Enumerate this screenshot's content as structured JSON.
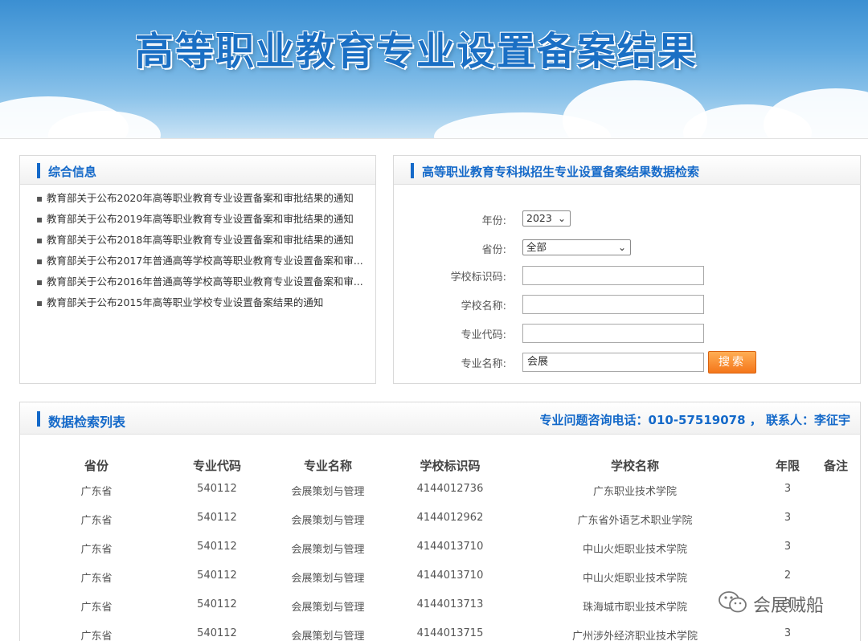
{
  "banner": {
    "title": "高等职业教育专业设置备案结果"
  },
  "info_panel": {
    "title": "综合信息",
    "items": [
      "教育部关于公布2020年高等职业教育专业设置备案和审批结果的通知",
      "教育部关于公布2019年高等职业教育专业设置备案和审批结果的通知",
      "教育部关于公布2018年高等职业教育专业设置备案和审批结果的通知",
      "教育部关于公布2017年普通高等学校高等职业教育专业设置备案和审...",
      "教育部关于公布2016年普通高等学校高等职业教育专业设置备案和审...",
      "教育部关于公布2015年高等职业学校专业设置备案结果的通知"
    ]
  },
  "search_panel": {
    "title": "高等职业教育专科拟招生专业设置备案结果数据检索",
    "year_label": "年份:",
    "year_value": "2023",
    "province_label": "省份:",
    "province_value": "全部",
    "school_code_label": "学校标识码:",
    "school_code_value": "",
    "school_name_label": "学校名称:",
    "school_name_value": "",
    "major_code_label": "专业代码:",
    "major_code_value": "",
    "major_name_label": "专业名称:",
    "major_name_value": "会展",
    "search_button": "搜索"
  },
  "list_panel": {
    "title": "数据检索列表",
    "hotline": "专业问题咨询电话：010-57519078 ，  联系人：李征宇",
    "columns": [
      "省份",
      "专业代码",
      "专业名称",
      "学校标识码",
      "学校名称",
      "年限",
      "备注"
    ],
    "rows": [
      [
        "广东省",
        "540112",
        "会展策划与管理",
        "4144012736",
        "广东职业技术学院",
        "3",
        ""
      ],
      [
        "广东省",
        "540112",
        "会展策划与管理",
        "4144012962",
        "广东省外语艺术职业学院",
        "3",
        ""
      ],
      [
        "广东省",
        "540112",
        "会展策划与管理",
        "4144013710",
        "中山火炬职业技术学院",
        "3",
        ""
      ],
      [
        "广东省",
        "540112",
        "会展策划与管理",
        "4144013710",
        "中山火炬职业技术学院",
        "2",
        ""
      ],
      [
        "广东省",
        "540112",
        "会展策划与管理",
        "4144013713",
        "珠海城市职业技术学院",
        "3",
        ""
      ],
      [
        "广东省",
        "540112",
        "会展策划与管理",
        "4144013715",
        "广州涉外经济职业技术学院",
        "3",
        ""
      ]
    ]
  },
  "watermark": {
    "text": "会展贼船",
    "icon": "wechat-icon"
  },
  "colors": {
    "accent": "#1469c9",
    "button": "#f4761a"
  }
}
